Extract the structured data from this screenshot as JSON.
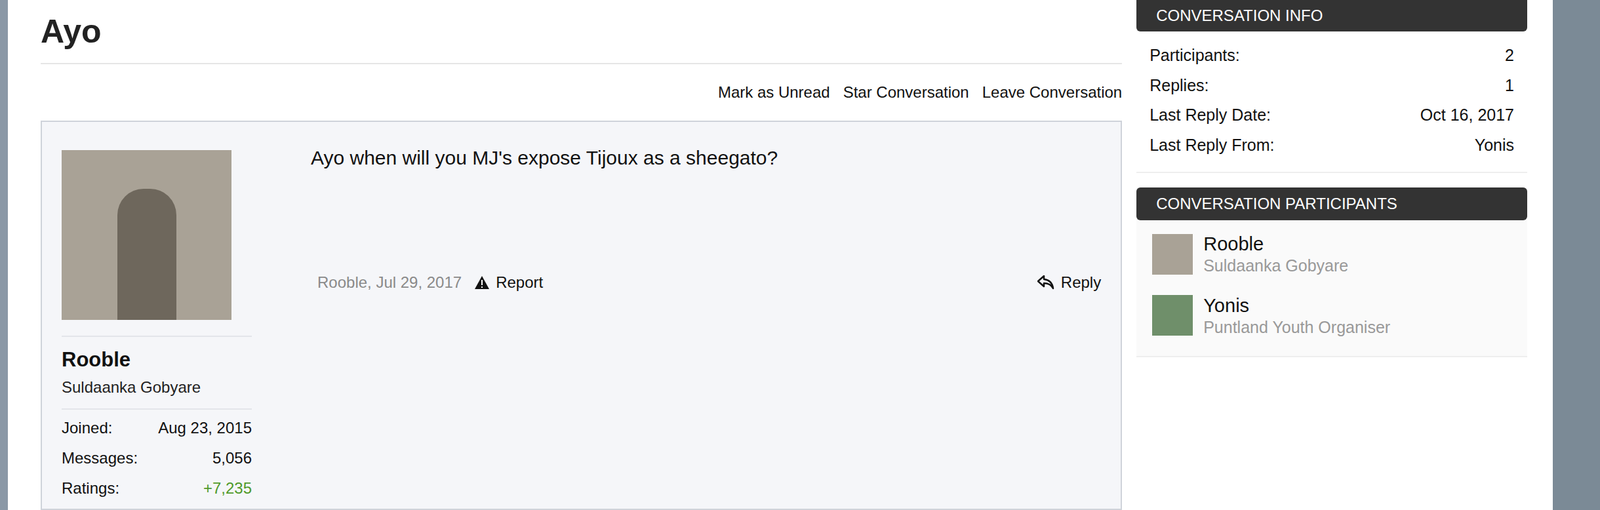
{
  "page": {
    "title": "Ayo"
  },
  "actions": [
    "Mark as Unread",
    "Star Conversation",
    "Leave Conversation"
  ],
  "author": {
    "name": "Rooble",
    "title": "Suldaanka Gobyare",
    "stats": [
      {
        "label": "Joined:",
        "value": "Aug 23, 2015"
      },
      {
        "label": "Messages:",
        "value": "5,056"
      },
      {
        "label": "Ratings:",
        "value": "+7,235"
      }
    ]
  },
  "message": {
    "text": "Ayo when will you MJ's expose Tijoux as a sheegato?",
    "byline": "Rooble, Jul 29, 2017",
    "report": "Report",
    "reply": "Reply"
  },
  "info": {
    "header": "CONVERSATION INFO",
    "rows": [
      {
        "label": "Participants:",
        "value": "2"
      },
      {
        "label": "Replies:",
        "value": "1"
      },
      {
        "label": "Last Reply Date:",
        "value": "Oct 16, 2017"
      },
      {
        "label": "Last Reply From:",
        "value": "Yonis"
      }
    ]
  },
  "participants": {
    "header": "CONVERSATION PARTICIPANTS",
    "items": [
      {
        "name": "Rooble",
        "title": "Suldaanka Gobyare"
      },
      {
        "name": "Yonis",
        "title": "Puntland Youth Organiser"
      }
    ]
  }
}
